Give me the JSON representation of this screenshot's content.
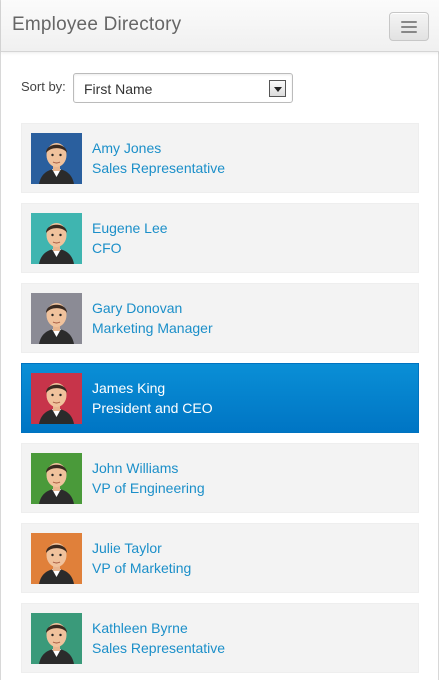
{
  "app": {
    "title": "Employee Directory",
    "menu_icon": "hamburger-menu-icon"
  },
  "sort": {
    "label": "Sort by:",
    "selected": "First Name"
  },
  "employees": [
    {
      "name": "Amy Jones",
      "title": "Sales Representative",
      "avatar_bg": "#2a5f9e",
      "selected": false
    },
    {
      "name": "Eugene Lee",
      "title": "CFO",
      "avatar_bg": "#3fb5b0",
      "selected": false
    },
    {
      "name": "Gary Donovan",
      "title": "Marketing Manager",
      "avatar_bg": "#8b8b95",
      "selected": false
    },
    {
      "name": "James King",
      "title": "President and CEO",
      "avatar_bg": "#c7344a",
      "selected": true
    },
    {
      "name": "John Williams",
      "title": "VP of Engineering",
      "avatar_bg": "#4a9a3a",
      "selected": false
    },
    {
      "name": "Julie Taylor",
      "title": "VP of Marketing",
      "avatar_bg": "#e0803a",
      "selected": false
    },
    {
      "name": "Kathleen Byrne",
      "title": "Sales Representative",
      "avatar_bg": "#3a9a7a",
      "selected": false
    }
  ],
  "colors": {
    "accent": "#0a86cf",
    "link": "#1b8fc9"
  }
}
